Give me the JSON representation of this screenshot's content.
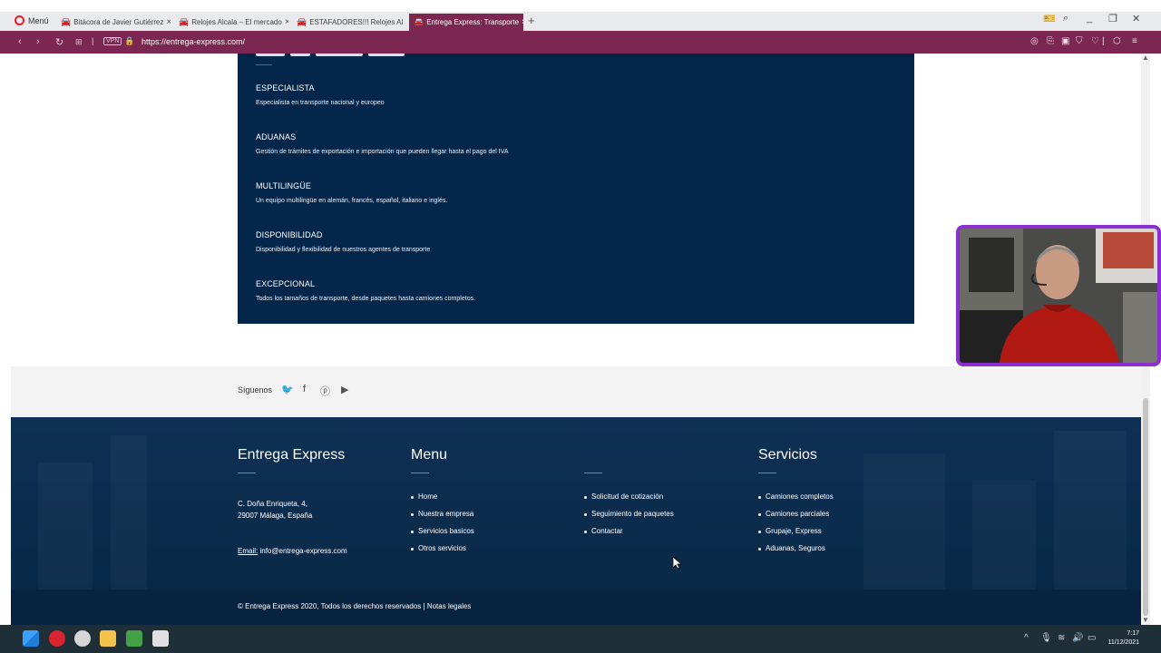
{
  "browser": {
    "menu_label": "Menú",
    "tabs": [
      {
        "label": "Bitácora de Javier Gutiérrez"
      },
      {
        "label": "Relojes Alcala – El mercado"
      },
      {
        "label": "ESTAFADORES!!! Relojes Al"
      },
      {
        "label": "Entrega Express: Transporte"
      }
    ],
    "url": "https://entrega-express.com/",
    "vpn_label": "VPN"
  },
  "features": [
    {
      "title": "ESPECIALISTA",
      "desc": "Especialista en transporte nacional y europeo"
    },
    {
      "title": "ADUANAS",
      "desc": "Gestión de trámites de exportación e importación que pueden llegar hasta el pago del IVA"
    },
    {
      "title": "MULTILINGÜE",
      "desc": "Un equipo multilingüe en alemán, francés, español, italiano e inglés."
    },
    {
      "title": "DISPONIBILIDAD",
      "desc": "Disponibilidad y flexibilidad de nuestros agentes de transporte"
    },
    {
      "title": "EXCEPCIONAL",
      "desc": "Todos los tamaños de transporte, desde paquetes hasta camiones completos."
    }
  ],
  "follow": {
    "label": "Síguenos",
    "icons": [
      "twitter-icon",
      "facebook-icon",
      "pinterest-icon",
      "youtube-icon"
    ]
  },
  "footer": {
    "company": {
      "title": "Entrega Express",
      "address_line1": "C. Doña Enriqueta, 4,",
      "address_line2": "29007 Málaga, España",
      "email_label": "Email:",
      "email": "info@entrega-express.com"
    },
    "menu": {
      "title": "Menu",
      "items": [
        "Home",
        "Nuestra empresa",
        "Servicios basicos",
        "Otros servicios"
      ]
    },
    "menu2": {
      "items": [
        "Solicitud de cotización",
        "Seguimiento de paquetes",
        "Contactar"
      ]
    },
    "services": {
      "title": "Servicios",
      "items": [
        "Camiones completos",
        "Camiones parciales",
        "Grupaje, Express",
        "Aduanas, Seguros"
      ]
    },
    "copyright": "© Entrega Express 2020, Todos los derechos reservados | Notas legales"
  },
  "taskbar": {
    "time": "7:17",
    "date": "11/12/2021"
  },
  "colors": {
    "browser_accent": "#7b2752",
    "features_bg": "#04264a",
    "footer_bg": "#0c2c4f",
    "webcam_border": "#8b2fd0"
  }
}
